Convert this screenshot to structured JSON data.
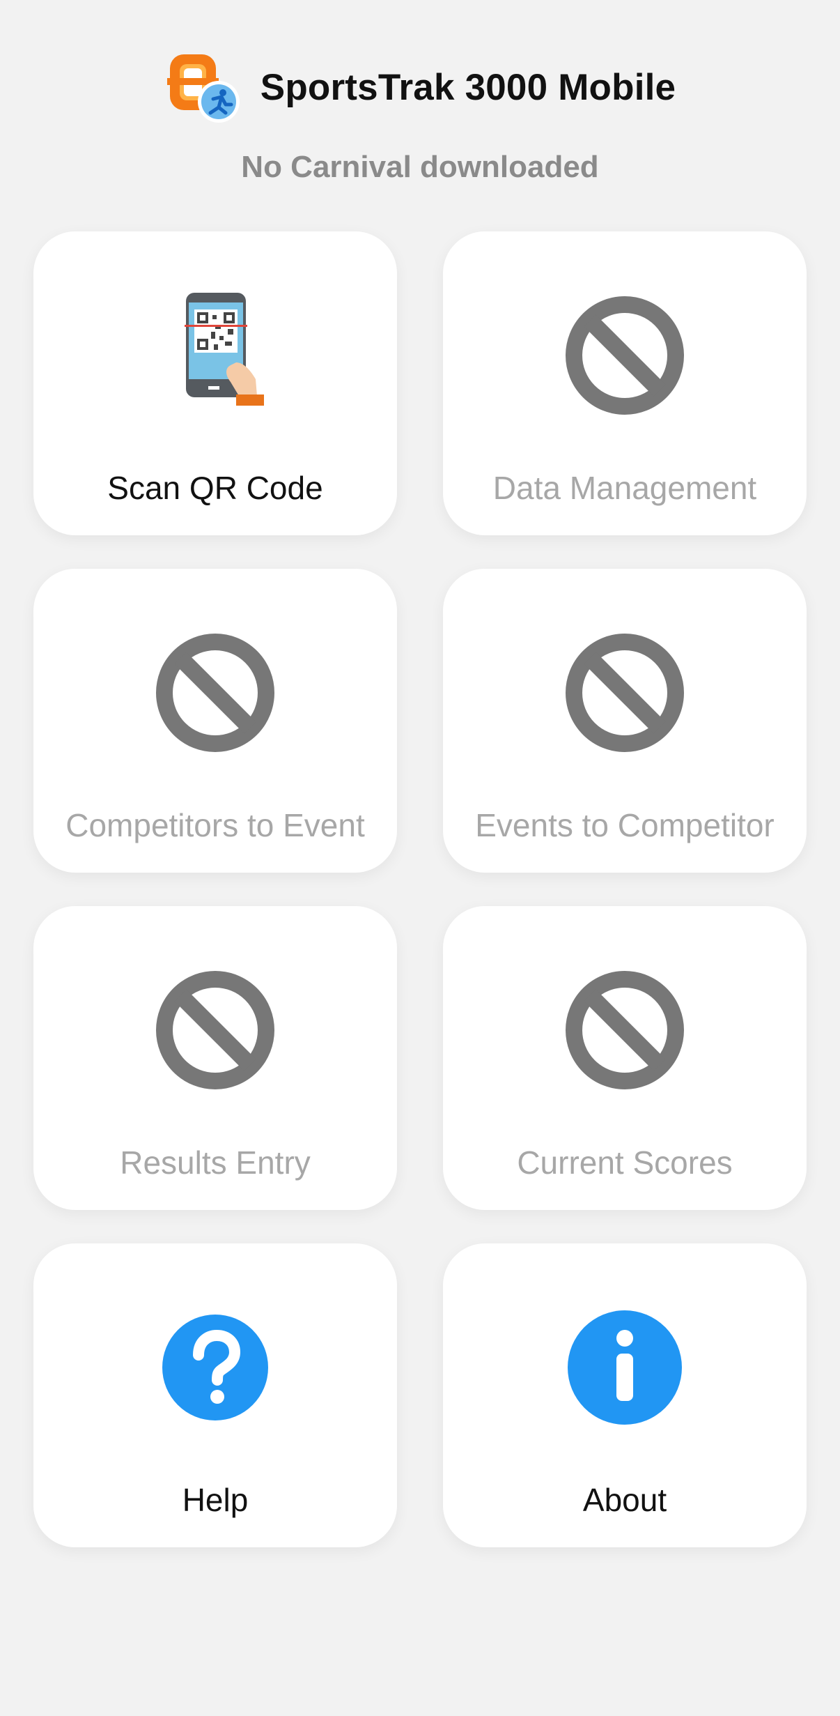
{
  "app": {
    "title": "SportsTrak 3000 Mobile",
    "status": "No Carnival downloaded",
    "logo_icon": "sportstrak-logo-icon"
  },
  "colors": {
    "background": "#f2f2f2",
    "tile": "#ffffff",
    "disabled_icon": "#777777",
    "disabled_text": "#a7a7a7",
    "accent_blue": "#2196f3",
    "logo_orange": "#f47b16"
  },
  "tiles": [
    {
      "label": "Scan QR Code",
      "icon": "scan-qr-code-icon",
      "enabled": true
    },
    {
      "label": "Data Management",
      "icon": "disabled-icon",
      "enabled": false
    },
    {
      "label": "Competitors to Event",
      "icon": "disabled-icon",
      "enabled": false
    },
    {
      "label": "Events to Competitor",
      "icon": "disabled-icon",
      "enabled": false
    },
    {
      "label": "Results Entry",
      "icon": "disabled-icon",
      "enabled": false
    },
    {
      "label": "Current Scores",
      "icon": "disabled-icon",
      "enabled": false
    },
    {
      "label": "Help",
      "icon": "help-icon",
      "enabled": true
    },
    {
      "label": "About",
      "icon": "info-icon",
      "enabled": true
    }
  ]
}
